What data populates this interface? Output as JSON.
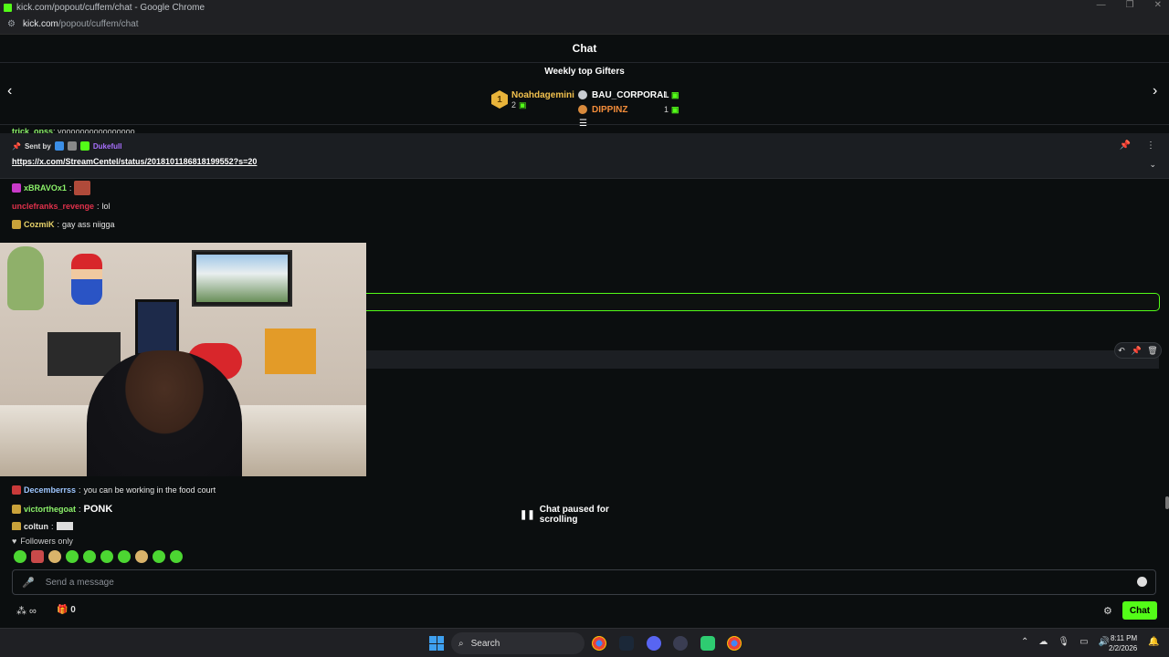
{
  "browser": {
    "title": "kick.com/popout/cuffem/chat - Google Chrome",
    "url_host": "kick.com",
    "url_path": "/popout/cuffem/chat"
  },
  "chat": {
    "header": "Chat"
  },
  "gifters": {
    "title": "Weekly top Gifters",
    "first": {
      "rank": "1",
      "name": "Noahdagemini",
      "count": "2"
    },
    "others": [
      {
        "name": "BAU_CORPORAL",
        "count": "1",
        "color": "#ffffff"
      },
      {
        "name": "DIPPINZ",
        "count": "1",
        "color": "#f28c3a"
      }
    ]
  },
  "pinned": {
    "sent_by_label": "Sent by",
    "user": "Dukefull",
    "link": "https://x.com/StreamCentel/status/2018101186818199552?s=20"
  },
  "messages": [
    {
      "user": "trick_opss",
      "text": "yoooooooooooooooo",
      "color": "#8cf26a"
    },
    {
      "user": "xBRAVOx1",
      "text": "",
      "color": "#e6e6e6"
    },
    {
      "user": "unclefranks_revenge",
      "text": "lol",
      "color": "#e0314b"
    },
    {
      "user": "CozmiK",
      "text": "gay ass niigga",
      "color": "#e8d36a"
    },
    {
      "user": "Decemberrss",
      "text": "you can be working in the food court",
      "color": "#9ec6ff"
    },
    {
      "user": "victorthegoat",
      "text": "",
      "color": "#8cf26a"
    },
    {
      "user": "coltun",
      "text": "",
      "color": "#e6e6e6"
    }
  ],
  "emote_text": "PONK",
  "paused_label": "Chat paused for scrolling",
  "followers_label": "Followers only",
  "input": {
    "placeholder": "Send a message"
  },
  "bottom": {
    "gift_count": "0",
    "chat_button": "Chat"
  },
  "taskbar": {
    "search_label": "Search",
    "time": "8:11 PM",
    "date": "2/2/2026"
  },
  "colors": {
    "accent": "#53fc18",
    "gold": "#f2c14e"
  }
}
